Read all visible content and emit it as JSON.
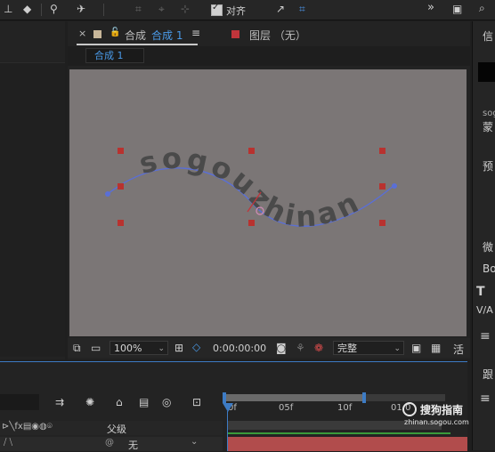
{
  "toolbar": {
    "align_label": "对齐"
  },
  "comp_panel": {
    "tab_prefix": "合成",
    "tab_name": "合成 1",
    "layer_label": "图层 （无）",
    "subtab": "合成 1"
  },
  "viewer": {
    "path_text": "sogouzhinan",
    "zoom": "100%",
    "timecode": "0:00:00:00",
    "quality": "完整",
    "active_label": "活"
  },
  "right_panel": {
    "info_label": "信",
    "sogou_label": "sog",
    "font_label": "蒙",
    "preview_label": "预",
    "micro_label": "微",
    "bo_label": "Bo",
    "track_label": "跟"
  },
  "timeline": {
    "parent_label": "父级",
    "none_label": "无",
    "ticks": [
      "0f",
      "05f",
      "10f",
      "01:0"
    ]
  },
  "watermark": {
    "brand": "搜狗指南",
    "url": "zhinan.sogou.com"
  },
  "colors": {
    "accent_blue": "#3d7bc4",
    "label_red": "#c0353b",
    "viewer_bg": "#7b7676",
    "path_blue": "#5a6fd6"
  }
}
